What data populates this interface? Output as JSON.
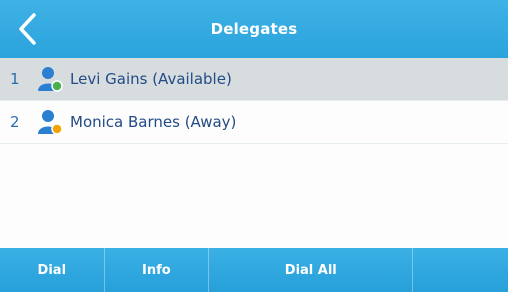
{
  "header": {
    "title": "Delegates",
    "back_icon": "chevron-left-icon"
  },
  "delegates": [
    {
      "index": "1",
      "label": "Levi Gains (Available)",
      "status": "available",
      "status_color": "#4caf50",
      "selected": true
    },
    {
      "index": "2",
      "label": "Monica Barnes (Away)",
      "status": "away",
      "status_color": "#f4a300",
      "selected": false
    }
  ],
  "softkeys": {
    "dial": "Dial",
    "info": "Info",
    "dial_all": "Dial All",
    "empty": ""
  },
  "colors": {
    "accent": "#2aa3dc",
    "selected_row": "#d7dcdf",
    "person_icon": "#2b7fd0"
  }
}
